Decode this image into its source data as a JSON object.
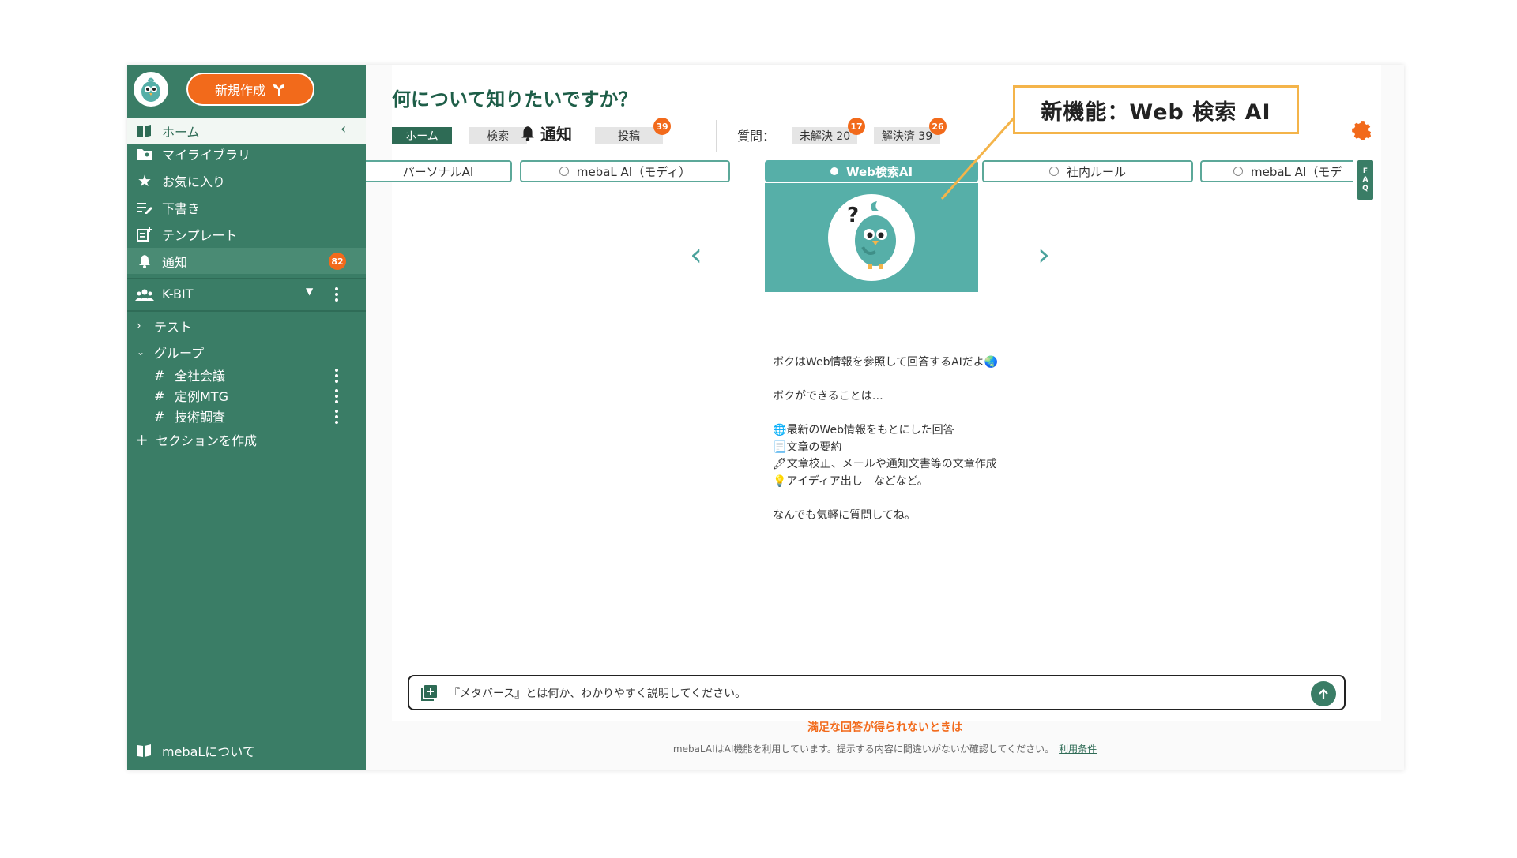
{
  "sidebar": {
    "new_button_label": "新規作成",
    "items": [
      {
        "label": "ホーム",
        "icon": "library-icon"
      },
      {
        "label": "マイライブラリ",
        "icon": "folder-user-icon"
      },
      {
        "label": "お気に入り",
        "icon": "star-icon"
      },
      {
        "label": "下書き",
        "icon": "edit-list-icon"
      },
      {
        "label": "テンプレート",
        "icon": "template-icon"
      },
      {
        "label": "通知",
        "icon": "bell-icon",
        "badge": "82"
      }
    ],
    "org": "K-BIT",
    "sections": {
      "test": "テスト",
      "group": "グループ",
      "channels": [
        "全社会議",
        "定例MTG",
        "技術調査"
      ],
      "hash": "#",
      "create": "セクションを作成"
    },
    "about": "mebaLについて"
  },
  "main": {
    "title": "何について知りたいですか？",
    "tabs": {
      "home": "ホーム",
      "search": "検索",
      "notify": "通知",
      "post": "投稿",
      "post_badge": "39"
    },
    "questions_label": "質問：",
    "unresolved": {
      "label": "未解決 20",
      "badge": "17"
    },
    "resolved": {
      "label": "解決済 39",
      "badge": "26"
    },
    "modes": [
      {
        "label": "パーソナルAI"
      },
      {
        "label": "mebaL AI（モディ）"
      },
      {
        "label": "Web検索AI",
        "selected": true
      },
      {
        "label": "社内ルール"
      },
      {
        "label": "mebaL AI（モデ"
      }
    ],
    "faq": [
      "F",
      "A",
      "Q"
    ],
    "description": [
      "ボクはWeb情報を参照して回答するAIだよ🌏",
      "",
      "ボクができることは…",
      "",
      "🌐最新のWeb情報をもとにした回答",
      "📃文章の要約",
      "🖊文章校正、メールや通知文書等の文章作成",
      "💡アイディア出し　などなど。",
      "",
      "なんでも気軽に質問してね。"
    ],
    "input_value": "『メタバース』とは何か、わかりやすく説明してください。",
    "unsatisfied": "満足な回答が得られないときは",
    "footer_note": "mebaLAIはAI機能を利用しています。提示する内容に間違いがないか確認してください。",
    "footer_link": "利用条件"
  },
  "callout": "新機能：Web 検索 AI",
  "colors": {
    "sidebar": "#3a7d66",
    "accent": "#f26a1b",
    "teal": "#56afa8",
    "callout_border": "#f4b44a"
  }
}
